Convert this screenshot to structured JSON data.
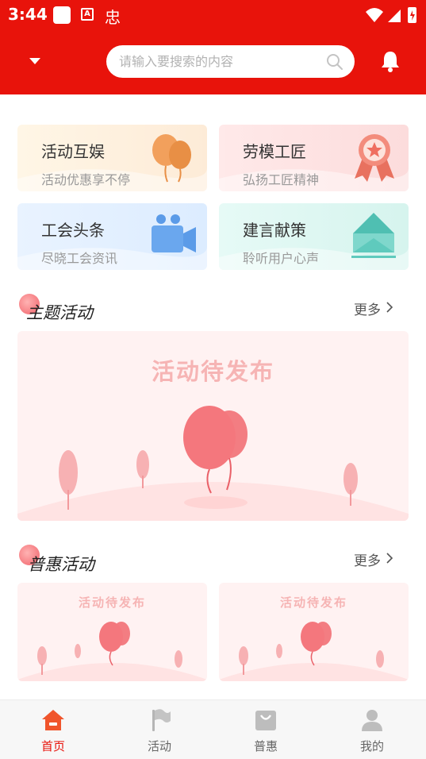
{
  "status_bar": {
    "time": "3:44",
    "icon_text_a": "A",
    "icon_bug": "忠"
  },
  "header": {
    "search_placeholder": "请输入要搜索的内容"
  },
  "cards": [
    {
      "title": "活动互娱",
      "subtitle": "活动优惠享不停"
    },
    {
      "title": "劳模工匠",
      "subtitle": "弘扬工匠精神"
    },
    {
      "title": "工会头条",
      "subtitle": "尽晓工会资讯"
    },
    {
      "title": "建言献策",
      "subtitle": "聆听用户心声"
    }
  ],
  "themed": {
    "title": "主题活动",
    "more": "更多",
    "banner_text": "活动待发布"
  },
  "benefit": {
    "title": "普惠活动",
    "more": "更多",
    "items": [
      {
        "text": "活动待发布"
      },
      {
        "text": "活动待发布"
      }
    ]
  },
  "nav": [
    {
      "label": "首页",
      "active": true
    },
    {
      "label": "活动",
      "active": false
    },
    {
      "label": "普惠",
      "active": false
    },
    {
      "label": "我的",
      "active": false
    }
  ],
  "colors": {
    "brand": "#e8130b",
    "nav_inactive": "#b5b5b5"
  }
}
